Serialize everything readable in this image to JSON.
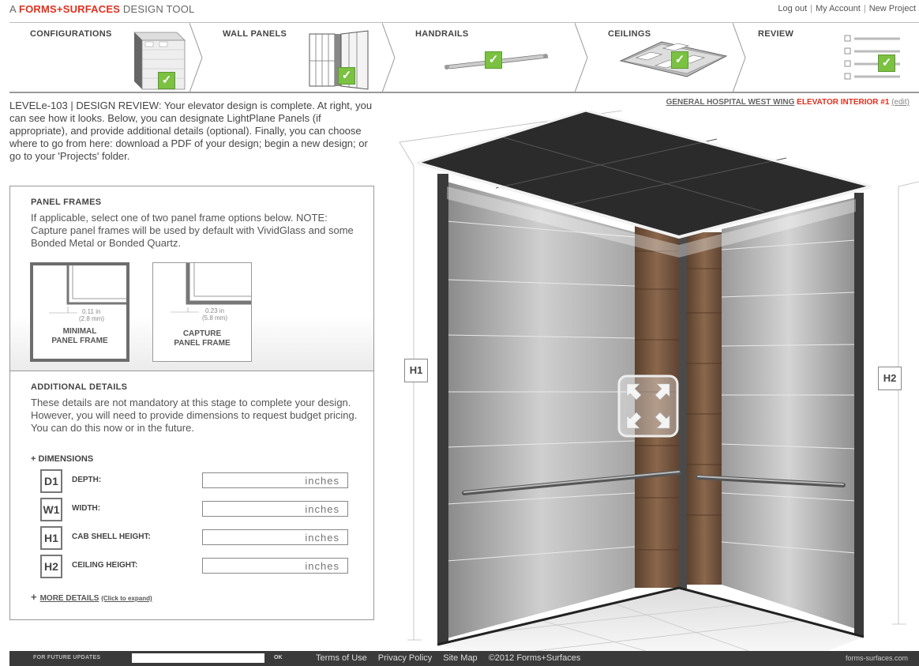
{
  "brand": {
    "prefix": "A ",
    "name": "FORMS+SURFACES",
    "suffix": " DESIGN TOOL"
  },
  "toplinks": {
    "logout": "Log out",
    "account": "My Account",
    "new_project": "New Project"
  },
  "steps": [
    {
      "label": "CONFIGURATIONS",
      "complete": true
    },
    {
      "label": "WALL PANELS",
      "complete": true
    },
    {
      "label": "HANDRAILS",
      "complete": true
    },
    {
      "label": "CEILINGS",
      "complete": true
    },
    {
      "label": "REVIEW",
      "complete": true
    }
  ],
  "check_glyph": "✓",
  "intro": "LEVELe-103 | DESIGN REVIEW: Your elevator design is complete. At right, you can see how it looks. Below, you can designate LightPlane Panels (if appropriate), and provide additional details (optional). Finally, you can choose where to go from here: download a PDF of your design; begin a new design; or go to your 'Projects' folder.",
  "panel_frames": {
    "title": "PANEL FRAMES",
    "text": "If applicable, select one of two panel frame options below. NOTE: Capture panel frames will be used by default with VividGlass and some Bonded Metal or Bonded Quartz.",
    "options": [
      {
        "dim1": "0.11 in",
        "dim2": "(2.8 mm)",
        "name1": "MINIMAL",
        "name2": "PANEL FRAME",
        "selected": true
      },
      {
        "dim1": "0.23 in",
        "dim2": "(5.8 mm)",
        "name1": "CAPTURE",
        "name2": "PANEL FRAME",
        "selected": false
      }
    ]
  },
  "additional": {
    "title": "ADDITIONAL DETAILS",
    "text": "These details are not mandatory at this stage to complete your design. However, you will need to provide dimensions to request budget pricing. You can do this now or in the future.",
    "dim_header": "+ DIMENSIONS",
    "rows": [
      {
        "code": "D1",
        "label": "DEPTH:",
        "placeholder": "inches"
      },
      {
        "code": "W1",
        "label": "WIDTH:",
        "placeholder": "inches"
      },
      {
        "code": "H1",
        "label": "CAB SHELL HEIGHT:",
        "placeholder": "inches"
      },
      {
        "code": "H2",
        "label": "CEILING HEIGHT:",
        "placeholder": "inches"
      }
    ],
    "more_plus": "+",
    "more_link": "MORE DETAILS",
    "more_hint": "(Click to expand)"
  },
  "project": {
    "name": "GENERAL HOSPITAL WEST WING",
    "interior": "ELEVATOR INTERIOR #1",
    "edit": "(edit)"
  },
  "markers": {
    "h1": "H1",
    "h2": "H2"
  },
  "footer": {
    "updates_label": "FOR FUTURE UPDATES",
    "ok": "OK",
    "links": [
      "Terms of Use",
      "Privacy Policy",
      "Site Map",
      "©2012 Forms+Surfaces"
    ],
    "domain": "forms-surfaces.com"
  },
  "colors": {
    "accent_red": "#e0301e",
    "check_green": "#7bc142"
  }
}
